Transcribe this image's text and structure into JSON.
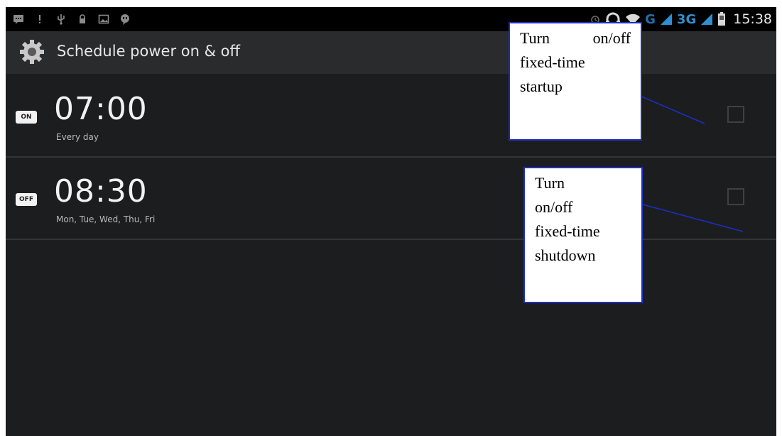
{
  "statusbar": {
    "net_g": "G",
    "net_3g": "3G",
    "time": "15:38",
    "icons_left": [
      "message-icon",
      "alert-icon",
      "usb-icon",
      "lock-icon",
      "image-icon",
      "chat-icon"
    ],
    "icons_right": [
      "alarm-icon",
      "headset-icon",
      "wifi-icon",
      "signal-icon",
      "signal-icon",
      "battery-icon"
    ]
  },
  "actionbar": {
    "title": "Schedule power on & off",
    "icon": "gear-icon"
  },
  "schedules": [
    {
      "badge": "ON",
      "time": "07:00",
      "repeat": "Every day",
      "enabled": false
    },
    {
      "badge": "OFF",
      "time": "08:30",
      "repeat": "Mon, Tue, Wed, Thu, Fri",
      "enabled": false
    }
  ],
  "callouts": {
    "startup": {
      "line1a": "Turn",
      "line1b": "on/off",
      "line2": "fixed-time",
      "line3": "startup"
    },
    "shutdown": {
      "line1": "Turn",
      "line2": "on/off",
      "line3": "fixed-time",
      "line4": "shutdown"
    }
  },
  "colors": {
    "callout_border": "#1c2fc4",
    "accent_blue": "#2e8fd0",
    "background": "#1c1d1f"
  }
}
